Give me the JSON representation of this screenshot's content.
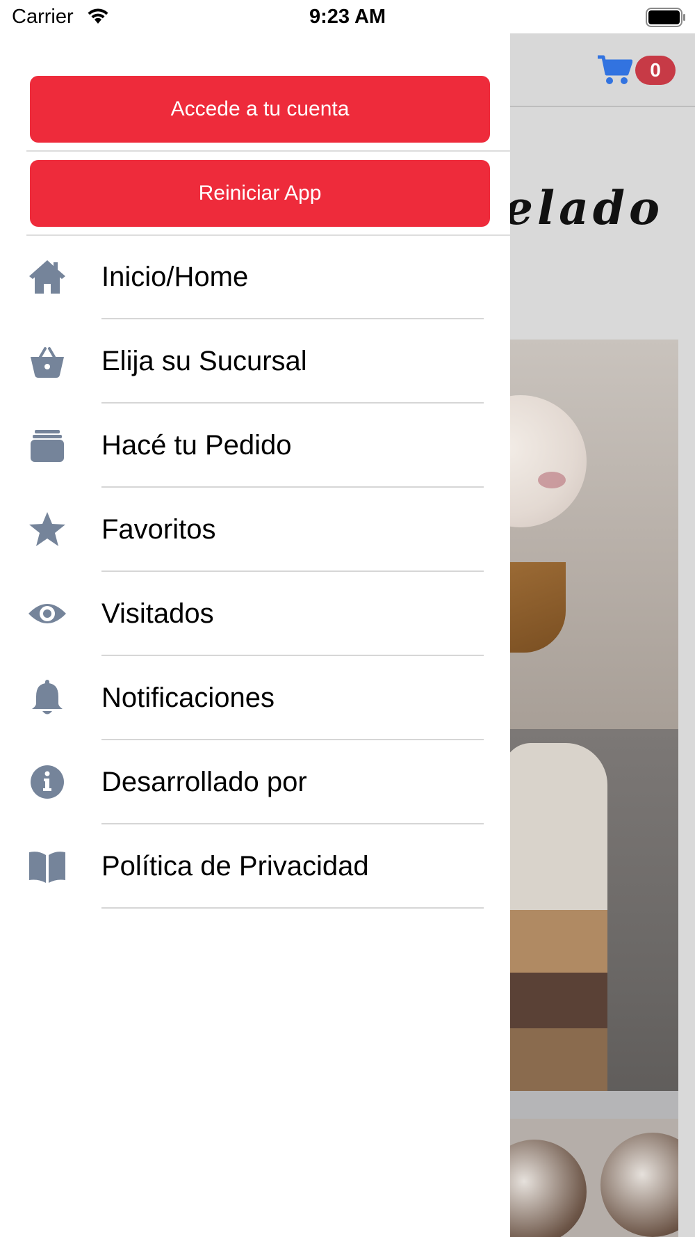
{
  "status_bar": {
    "carrier": "Carrier",
    "time": "9:23 AM",
    "icons": [
      "wifi-icon",
      "battery-icon"
    ]
  },
  "background_app": {
    "cart_count": "0",
    "brand_fragment": "elado",
    "icons": [
      "cart-icon"
    ]
  },
  "drawer": {
    "login_button": "Accede a tu cuenta",
    "reset_button": "Reiniciar App",
    "items": [
      {
        "label": "Inicio/Home",
        "icon": "home-icon"
      },
      {
        "label": "Elija su Sucursal",
        "icon": "basket-icon"
      },
      {
        "label": "Hacé tu Pedido",
        "icon": "layers-icon"
      },
      {
        "label": "Favoritos",
        "icon": "star-icon"
      },
      {
        "label": "Visitados",
        "icon": "eye-icon"
      },
      {
        "label": "Notificaciones",
        "icon": "bell-icon"
      },
      {
        "label": "Desarrollado por",
        "icon": "info-icon"
      },
      {
        "label": "Política de Privacidad",
        "icon": "book-icon"
      }
    ]
  },
  "colors": {
    "accent_red": "#ee2b3b",
    "icon_gray": "#75849a",
    "cart_blue": "#3273e0",
    "badge_red": "#c73a46"
  }
}
